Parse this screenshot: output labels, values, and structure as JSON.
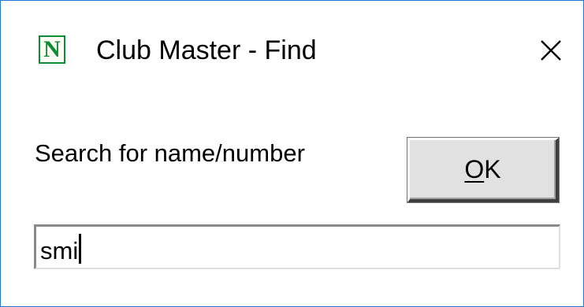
{
  "window": {
    "title": "Club Master - Find",
    "app_icon_letter": "N",
    "app_icon_color": "#0c8d35",
    "border_color": "#1f78d6",
    "close_icon": "close-icon"
  },
  "form": {
    "search_label": "Search for name/number",
    "ok_button": {
      "mnemonic": "O",
      "rest": "K"
    },
    "search_input": {
      "value": "smi",
      "placeholder": ""
    }
  }
}
